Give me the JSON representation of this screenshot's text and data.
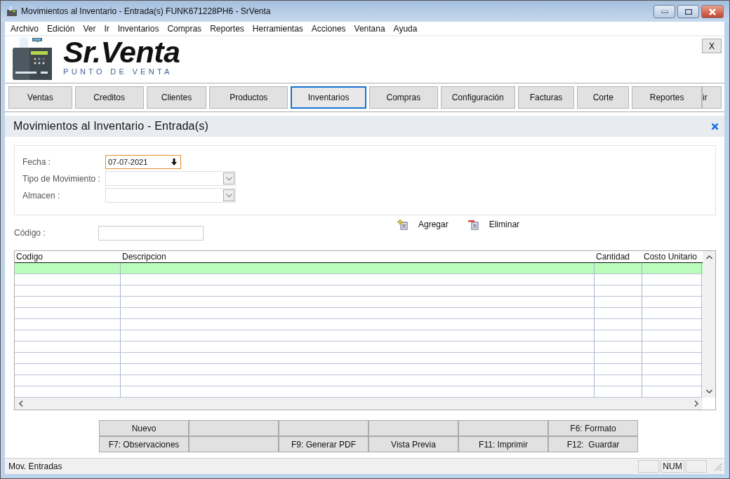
{
  "window": {
    "title": "Movimientos al Inventario - Entrada(s) FUNK671228PH6 - SrVenta"
  },
  "menu": [
    "Archivo",
    "Edición",
    "Ver",
    "Ir",
    "Inventarios",
    "Compras",
    "Reportes",
    "Herramientas",
    "Acciones",
    "Ventana",
    "Ayuda"
  ],
  "logo": {
    "name": "Sr.Venta",
    "tagline": "PUNTO DE VENTA"
  },
  "close_label": "X",
  "nav": [
    {
      "label": "Ventas",
      "selected": false
    },
    {
      "label": "Creditos",
      "selected": false
    },
    {
      "label": "Clientes",
      "selected": false
    },
    {
      "label": "Productos",
      "selected": false
    },
    {
      "label": "Inventarios",
      "selected": true
    },
    {
      "label": "Compras",
      "selected": false
    },
    {
      "label": "Configuración",
      "selected": false
    },
    {
      "label": "Facturas",
      "selected": false
    },
    {
      "label": "Corte",
      "selected": false
    },
    {
      "label": "Reportes",
      "selected": false
    },
    {
      "label": "ir",
      "selected": false
    }
  ],
  "panel": {
    "title": "Movimientos al Inventario - Entrada(s)"
  },
  "form": {
    "fecha_label": "Fecha :",
    "fecha_value": "07-07-2021",
    "tipo_label": "Tipo de Movimiento :",
    "almacen_label": "Almacen :"
  },
  "codigo_label": "Código :",
  "actions": [
    {
      "kind": "add",
      "label": "Agregar"
    },
    {
      "kind": "remove",
      "label": "Eliminar"
    }
  ],
  "table": {
    "columns": [
      "Codigo",
      "Descripcion",
      "Cantidad",
      "Costo Unitario"
    ],
    "rows": [
      {
        "selected": true
      },
      {
        "selected": false
      },
      {
        "selected": false
      },
      {
        "selected": false
      },
      {
        "selected": false
      },
      {
        "selected": false
      },
      {
        "selected": false
      },
      {
        "selected": false
      },
      {
        "selected": false
      },
      {
        "selected": false
      },
      {
        "selected": false
      },
      {
        "selected": false
      }
    ]
  },
  "buttons": [
    {
      "kind": "button",
      "label": "Nuevo"
    },
    {
      "kind": "blank"
    },
    {
      "kind": "blank"
    },
    {
      "kind": "blank"
    },
    {
      "kind": "blank"
    },
    {
      "kind": "button",
      "label": "F6: Formato"
    },
    {
      "kind": "button",
      "label": "F7: Observaciones"
    },
    {
      "kind": "blank"
    },
    {
      "kind": "button",
      "label": "F9: Generar PDF"
    },
    {
      "kind": "button",
      "label": "Vista Previa"
    },
    {
      "kind": "button",
      "label": "F11: Imprimir"
    },
    {
      "kind": "button",
      "label": "F12:  Guardar"
    }
  ],
  "status_bar": {
    "message": "Mov. Entradas",
    "indicator": "NUM"
  }
}
